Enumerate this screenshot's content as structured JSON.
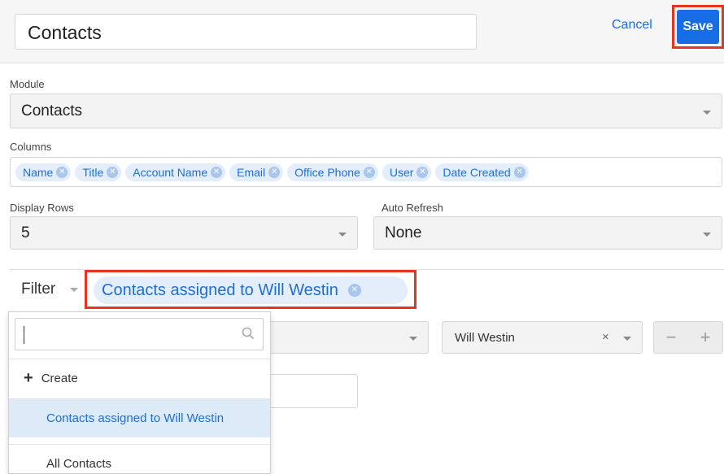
{
  "header": {
    "title_value": "Contacts",
    "cancel_label": "Cancel",
    "save_label": "Save"
  },
  "module": {
    "label": "Module",
    "value": "Contacts"
  },
  "columns": {
    "label": "Columns",
    "items": [
      "Name",
      "Title",
      "Account Name",
      "Email",
      "Office Phone",
      "User",
      "Date Created"
    ]
  },
  "display_rows": {
    "label": "Display Rows",
    "value": "5"
  },
  "auto_refresh": {
    "label": "Auto Refresh",
    "value": "None"
  },
  "filter": {
    "label": "Filter",
    "selected": "Contacts assigned to Will Westin"
  },
  "filter_row": {
    "user_value": "Will Westin",
    "clear_glyph": "×",
    "minus_glyph": "−",
    "plus_glyph": "+"
  },
  "dropdown": {
    "search_value": "",
    "create_glyph": "+",
    "create_label": "Create",
    "items": [
      "Contacts assigned to Will Westin",
      "All Contacts"
    ]
  },
  "colors": {
    "accent": "#176de5",
    "highlight": "#e8341c",
    "pill_bg": "#e4eefa"
  }
}
